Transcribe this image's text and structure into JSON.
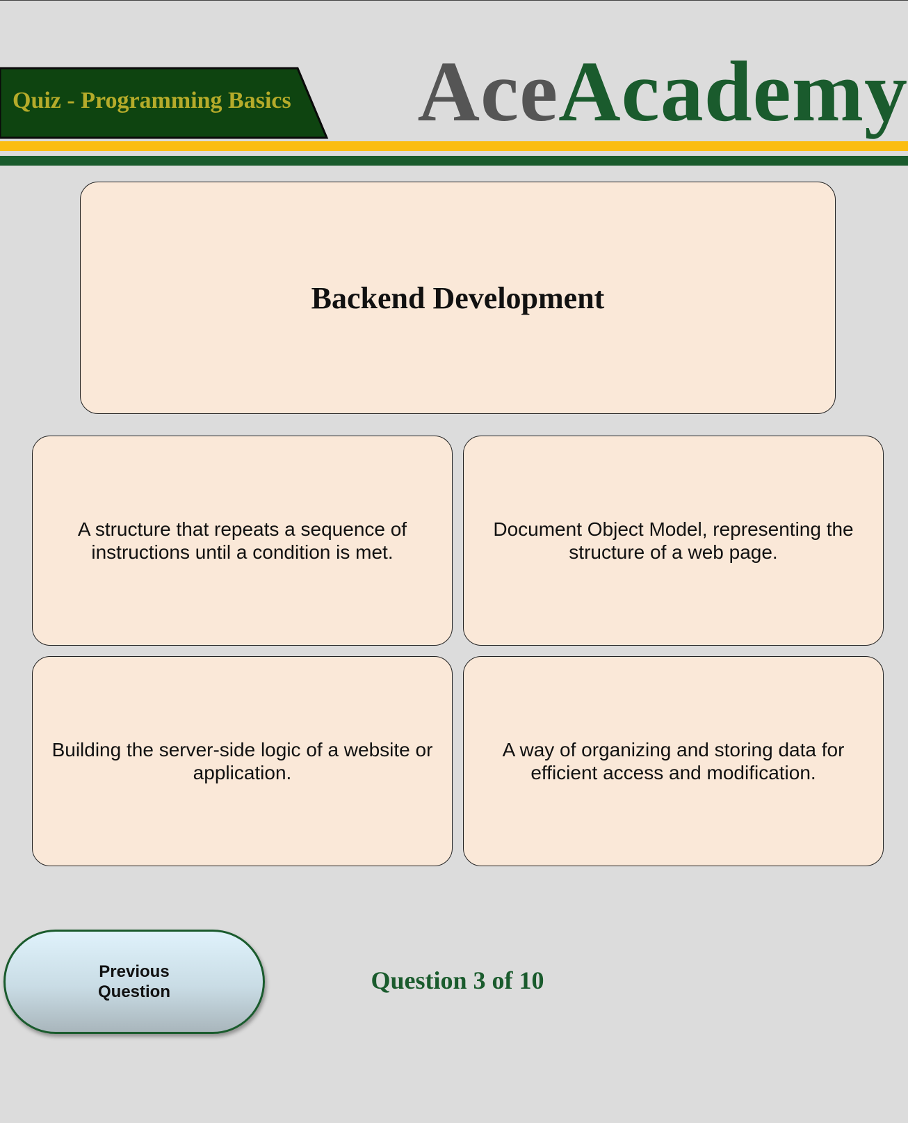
{
  "header": {
    "quiz_title": "Quiz - Programming Basics",
    "brand": {
      "part1": "Ace",
      "part2": "Academy"
    },
    "colors": {
      "tab_background": "#0e4410",
      "tab_text": "#b5ab2a",
      "brand_grey": "#555555",
      "brand_green": "#1a5b2d",
      "stripe_gold": "#fbbd12",
      "stripe_green": "#1a5b2d"
    }
  },
  "question": {
    "term": "Backend Development"
  },
  "answers": [
    "A structure that repeats a sequence of instructions until a condition is met.",
    "Document Object Model, representing the structure of a web page.",
    "Building the server-side logic of a website or application.",
    "A way of organizing and storing data for efficient access and modification."
  ],
  "footer": {
    "previous_button_label": "Previous Question",
    "progress_text": "Question 3 of 10"
  }
}
